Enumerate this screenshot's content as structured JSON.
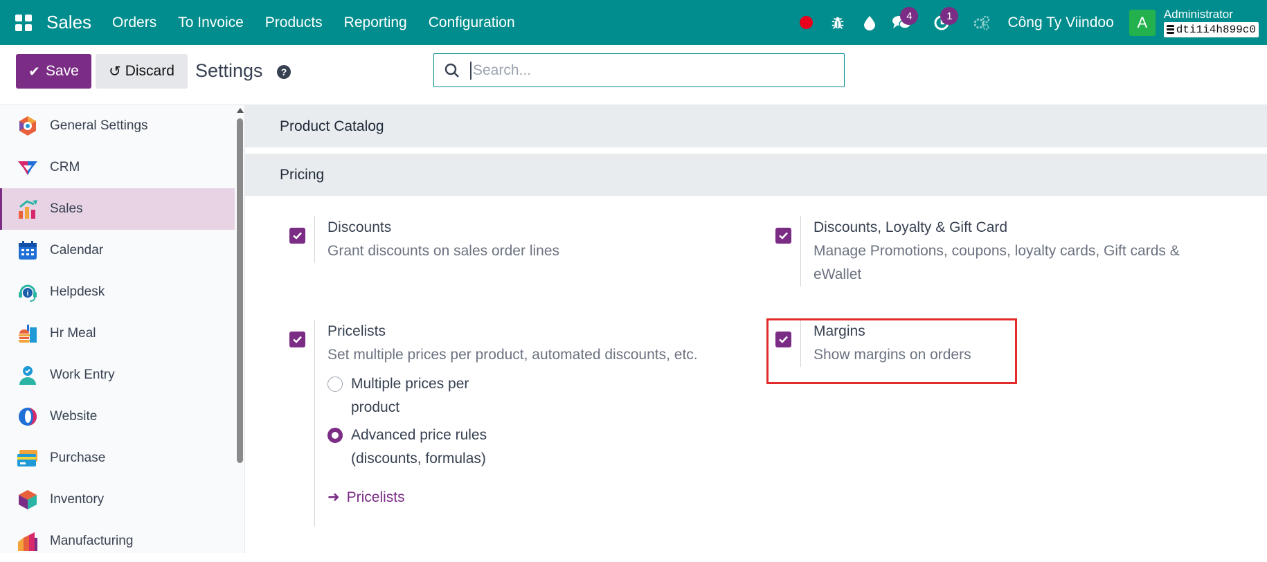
{
  "navbar": {
    "brand": "Sales",
    "menu": [
      "Orders",
      "To Invoice",
      "Products",
      "Reporting",
      "Configuration"
    ],
    "messages_badge": "4",
    "activities_badge": "1",
    "company": "Công Ty Viindoo",
    "avatar_letter": "A",
    "user_name": "Administrator",
    "database": "dti1i4h899c0",
    "colors": {
      "bar": "#018d8d",
      "badge": "#7b2d85",
      "record": "#e8001c"
    }
  },
  "control": {
    "save_label": "Save",
    "discard_label": "Discard",
    "title": "Settings",
    "search_placeholder": "Search..."
  },
  "sidebar": {
    "items": [
      {
        "label": "General Settings",
        "icon": "general-settings-icon"
      },
      {
        "label": "CRM",
        "icon": "crm-icon"
      },
      {
        "label": "Sales",
        "icon": "sales-icon",
        "active": true
      },
      {
        "label": "Calendar",
        "icon": "calendar-icon"
      },
      {
        "label": "Helpdesk",
        "icon": "helpdesk-icon"
      },
      {
        "label": "Hr Meal",
        "icon": "hr-meal-icon"
      },
      {
        "label": "Work Entry",
        "icon": "work-entry-icon"
      },
      {
        "label": "Website",
        "icon": "website-icon"
      },
      {
        "label": "Purchase",
        "icon": "purchase-icon"
      },
      {
        "label": "Inventory",
        "icon": "inventory-icon"
      },
      {
        "label": "Manufacturing",
        "icon": "manufacturing-icon"
      }
    ]
  },
  "main": {
    "sections": {
      "catalog": "Product Catalog",
      "pricing": "Pricing"
    },
    "discounts": {
      "title": "Discounts",
      "desc": "Grant discounts on sales order lines",
      "checked": true
    },
    "loyalty": {
      "title": "Discounts, Loyalty & Gift Card",
      "desc_line1": "Manage Promotions, coupons, loyalty cards, Gift cards &",
      "desc_line2": "eWallet",
      "checked": true
    },
    "pricelists": {
      "title": "Pricelists",
      "desc": "Set multiple prices per product, automated discounts, etc.",
      "checked": true,
      "options": [
        {
          "line1": "Multiple prices per",
          "line2": "product",
          "selected": false
        },
        {
          "line1": "Advanced price rules",
          "line2": "(discounts, formulas)",
          "selected": true
        }
      ],
      "link": "Pricelists"
    },
    "margins": {
      "title": "Margins",
      "desc": "Show margins on orders",
      "checked": true
    },
    "accent_color": "#7b2d85",
    "highlight_color": "#e32b2b"
  }
}
